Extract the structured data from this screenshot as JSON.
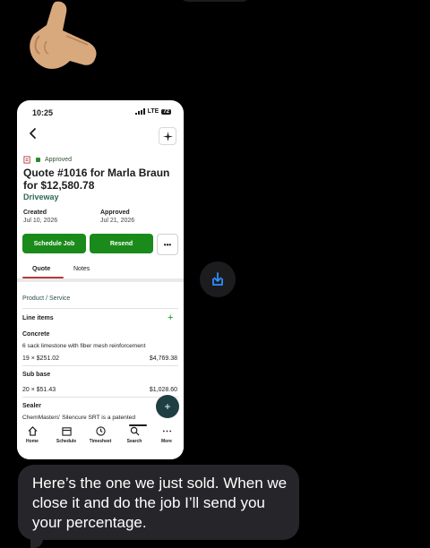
{
  "phone": {
    "status_bar": {
      "time": "10:25",
      "network": "LTE",
      "battery": "72"
    },
    "quote": {
      "status": "Approved",
      "title": "Quote #1016 for Marla Braun for $12,580.78",
      "subtitle": "Driveway",
      "created_label": "Created",
      "created_value": "Jul 10, 2026",
      "approved_label": "Approved",
      "approved_value": "Jul 21, 2026"
    },
    "actions": {
      "schedule": "Schedule Job",
      "resend": "Resend",
      "more": "•••"
    },
    "tabs": [
      {
        "label": "Quote"
      },
      {
        "label": "Notes"
      }
    ],
    "section_label": "Product / Service",
    "line_items_label": "Line items",
    "line_items": [
      {
        "name": "Concrete",
        "description": "6 sack limestone with fiber mesh reinforcement",
        "qty_price": "19 × $251.02",
        "total": "$4,769.38"
      },
      {
        "name": "Sub base",
        "description": "",
        "qty_price": "20 × $51.43",
        "total": "$1,028.60"
      },
      {
        "name": "Sealer",
        "description": "ChemMasters' Silencure SRT is a patented",
        "qty_price": "",
        "total": ""
      }
    ],
    "bottom_nav": [
      {
        "label": "Home",
        "icon": "home-icon"
      },
      {
        "label": "Schedule",
        "icon": "calendar-icon"
      },
      {
        "label": "Timesheet",
        "icon": "clock-icon"
      },
      {
        "label": "Search",
        "icon": "search-icon"
      },
      {
        "label": "More",
        "icon": "more-icon"
      }
    ]
  },
  "message": {
    "text": "Here’s the one we just sold. When we close it and do the job I’ll send you your percentage."
  },
  "colors": {
    "brand_green": "#1a8a1a",
    "accent_red": "#b5393b",
    "fab": "#1f3e44",
    "bubble": "#26262a"
  }
}
